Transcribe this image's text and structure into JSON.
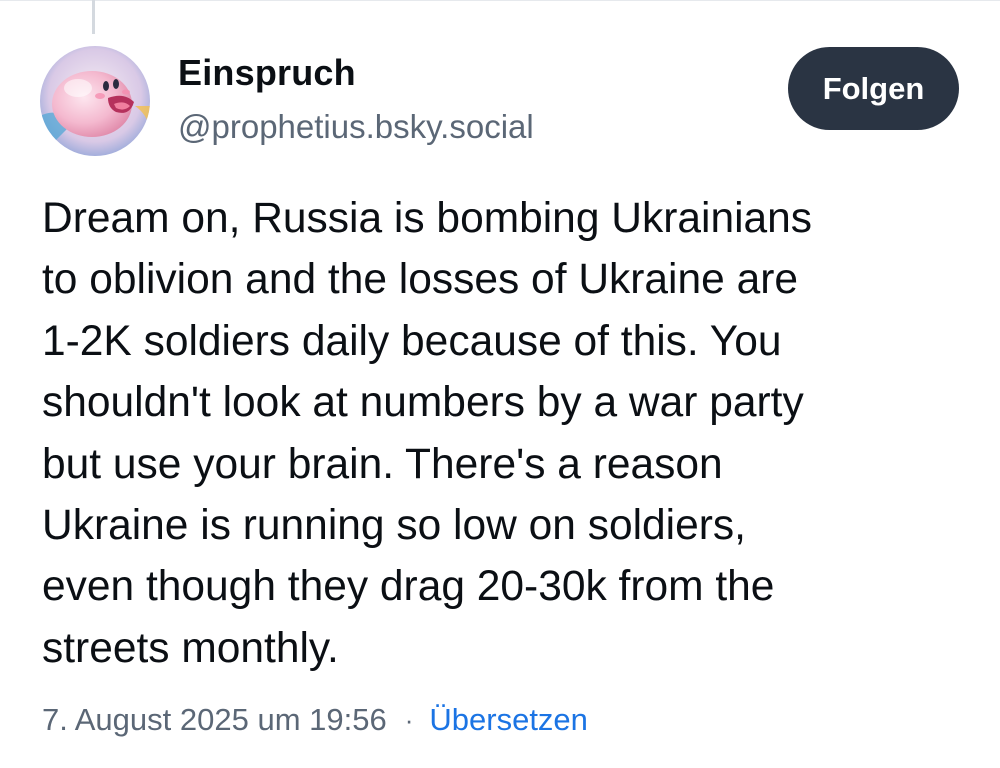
{
  "author": {
    "display_name": "Einspruch",
    "handle": "@prophetius.bsky.social"
  },
  "follow_button": {
    "label": "Folgen"
  },
  "post": {
    "text": "Dream on, Russia is bombing Ukrainians\nto oblivion and the losses of Ukraine are\n1-2K soldiers daily because of this. You\nshouldn't look at numbers by a war party\nbut use your brain. There's a reason\nUkraine is running so low on soldiers,\neven though they drag 20-30k from the\nstreets monthly.",
    "timestamp": "7. August 2025 um 19:56",
    "separator": "·",
    "translate_label": "Übersetzen"
  },
  "colors": {
    "follow_button_bg": "#2a3443",
    "handle_text": "#5b6776",
    "link": "#1b74e4"
  }
}
